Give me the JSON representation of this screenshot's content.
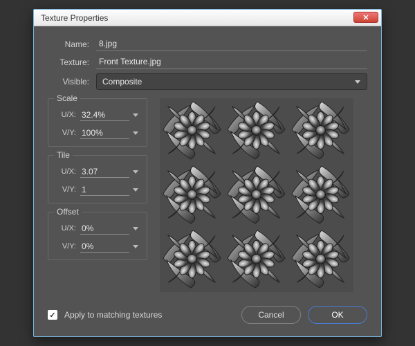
{
  "window": {
    "title": "Texture Properties",
    "close_icon": "✕"
  },
  "fields": {
    "name_label": "Name:",
    "name_value": "8.jpg",
    "texture_label": "Texture:",
    "texture_value": "Front Texture.jpg",
    "visible_label": "Visible:",
    "visible_value": "Composite"
  },
  "groups": {
    "scale": {
      "title": "Scale",
      "ux_label": "U/X:",
      "ux_value": "32.4%",
      "vy_label": "V/Y:",
      "vy_value": "100%"
    },
    "tile": {
      "title": "Tile",
      "ux_label": "U/X:",
      "ux_value": "3.07",
      "vy_label": "V/Y:",
      "vy_value": "1"
    },
    "offset": {
      "title": "Offset",
      "ux_label": "U/X:",
      "ux_value": "0%",
      "vy_label": "V/Y:",
      "vy_value": "0%"
    }
  },
  "footer": {
    "apply_label": "Apply to matching textures",
    "apply_checked": true,
    "cancel": "Cancel",
    "ok": "OK"
  }
}
